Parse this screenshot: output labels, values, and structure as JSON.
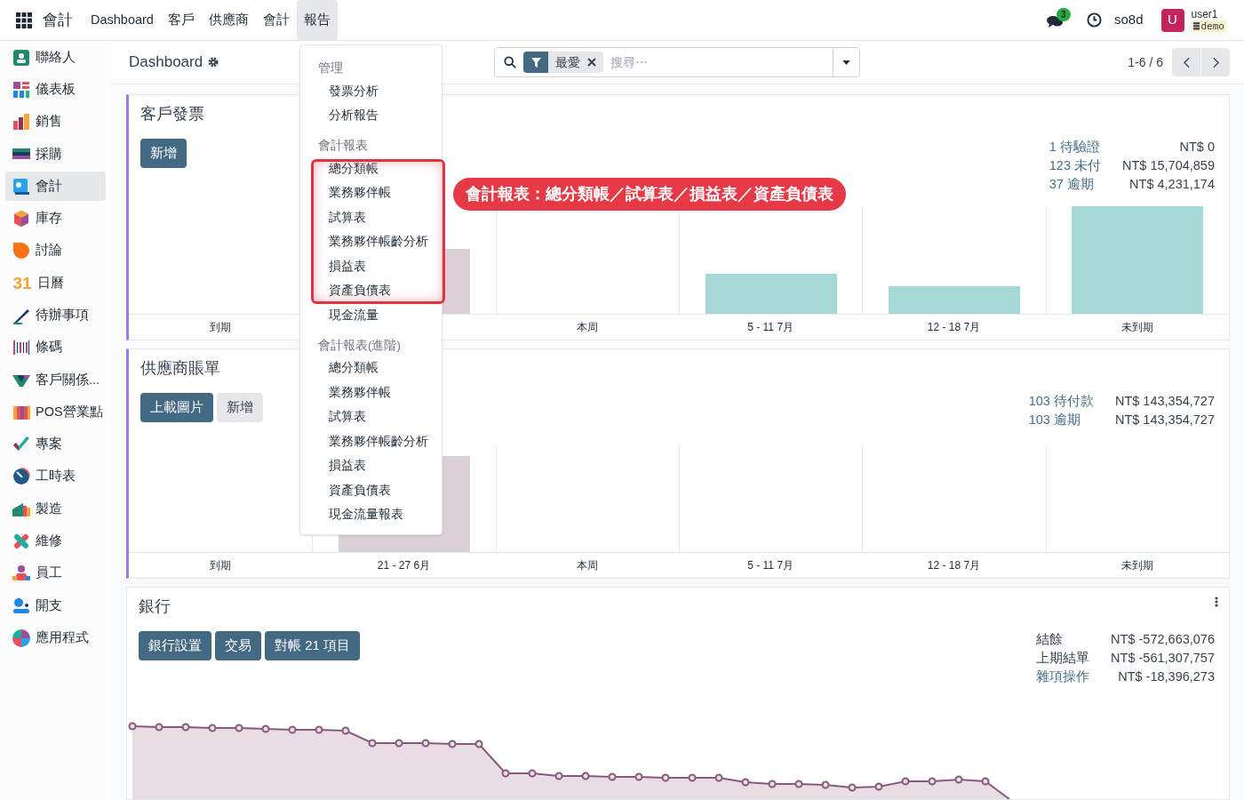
{
  "topbar": {
    "app_title": "會計",
    "menu": [
      {
        "label": "Dashboard",
        "selected": false
      },
      {
        "label": "客戶",
        "selected": false
      },
      {
        "label": "供應商",
        "selected": false
      },
      {
        "label": "會計",
        "selected": false
      },
      {
        "label": "報告",
        "selected": true
      }
    ],
    "messages_badge": "3",
    "company": "so8d",
    "avatar": "U",
    "user": "user1",
    "database": "demo"
  },
  "sidebar": {
    "items": [
      {
        "label": "聯絡人",
        "selected": false
      },
      {
        "label": "儀表板",
        "selected": false
      },
      {
        "label": "銷售",
        "selected": false
      },
      {
        "label": "採購",
        "selected": false
      },
      {
        "label": "會計",
        "selected": true
      },
      {
        "label": "庫存",
        "selected": false
      },
      {
        "label": "討論",
        "selected": false
      },
      {
        "label": "日曆",
        "selected": false,
        "icon_text": "31"
      },
      {
        "label": "待辦事項",
        "selected": false
      },
      {
        "label": "條碼",
        "selected": false
      },
      {
        "label": "客戶關係...",
        "selected": false
      },
      {
        "label": "POS營業點",
        "selected": false
      },
      {
        "label": "專案",
        "selected": false
      },
      {
        "label": "工時表",
        "selected": false
      },
      {
        "label": "製造",
        "selected": false
      },
      {
        "label": "維修",
        "selected": false
      },
      {
        "label": "員工",
        "selected": false
      },
      {
        "label": "開支",
        "selected": false
      },
      {
        "label": "應用程式",
        "selected": false
      }
    ]
  },
  "control_panel": {
    "breadcrumb": "Dashboard",
    "search": {
      "facet": "最愛",
      "placeholder": "搜尋⋯"
    },
    "pager": "1-6 / 6"
  },
  "reports_menu": {
    "sections": [
      {
        "heading": "管理",
        "items": [
          "發票分析",
          "分析報告"
        ]
      },
      {
        "heading": "會計報表",
        "items": [
          "總分類帳",
          "業務夥伴帳",
          "試算表",
          "業務夥伴帳齡分析",
          "損益表",
          "資產負債表",
          "現金流量"
        ]
      },
      {
        "heading": "會計報表(進階)",
        "items": [
          "總分類帳",
          "業務夥伴帳",
          "試算表",
          "業務夥伴帳齡分析",
          "損益表",
          "資產負債表",
          "現金流量報表"
        ]
      }
    ]
  },
  "annotation": {
    "text": "會計報表：總分類帳／試算表／損益表／資產負債表"
  },
  "cards": [
    {
      "kind": "bars",
      "title": "客戶發票",
      "buttons": [
        {
          "label": "新增",
          "kind": "primary"
        }
      ],
      "stats": [
        {
          "label": "1 待驗證",
          "value": "NT$ 0",
          "kind": "link"
        },
        {
          "label": "123 未付",
          "value": "NT$ 15,704,859",
          "kind": "link"
        },
        {
          "label": "37 逾期",
          "value": "NT$ 4,231,174",
          "kind": "link"
        }
      ],
      "columns": [
        {
          "label": "到期"
        },
        {},
        {
          "label": "本周"
        },
        {
          "label": "5 - 11 7月"
        },
        {
          "label": "12 - 18 7月"
        },
        {
          "label": "未到期"
        }
      ]
    },
    {
      "kind": "bars",
      "title": "供應商賬單",
      "buttons": [
        {
          "label": "上載圖片",
          "kind": "primary"
        },
        {
          "label": "新增",
          "kind": "secondary"
        }
      ],
      "stats": [
        {
          "label": "103 待付款",
          "value": "NT$ 143,354,727",
          "kind": "link"
        },
        {
          "label": "103 逾期",
          "value": "NT$ 143,354,727",
          "kind": "link"
        }
      ],
      "columns": [
        {
          "label": "到期"
        },
        {
          "label": "21 - 27 6月"
        },
        {
          "label": "本周"
        },
        {
          "label": "5 - 11 7月"
        },
        {
          "label": "12 - 18 7月"
        },
        {
          "label": "未到期"
        }
      ]
    },
    {
      "kind": "line",
      "title": "銀行",
      "buttons": [
        {
          "label": "銀行設置",
          "kind": "primary"
        },
        {
          "label": "交易",
          "kind": "primary"
        },
        {
          "label": "對帳 21 項目",
          "kind": "primary"
        }
      ],
      "stats": [
        {
          "label": "結餘",
          "value": "NT$ -572,663,076",
          "kind": "plain"
        },
        {
          "label": "上期結單",
          "value": "NT$ -561,307,757",
          "kind": "plain"
        },
        {
          "label": "雜項操作",
          "value": "NT$ -18,396,273",
          "kind": "link"
        }
      ]
    }
  ]
}
